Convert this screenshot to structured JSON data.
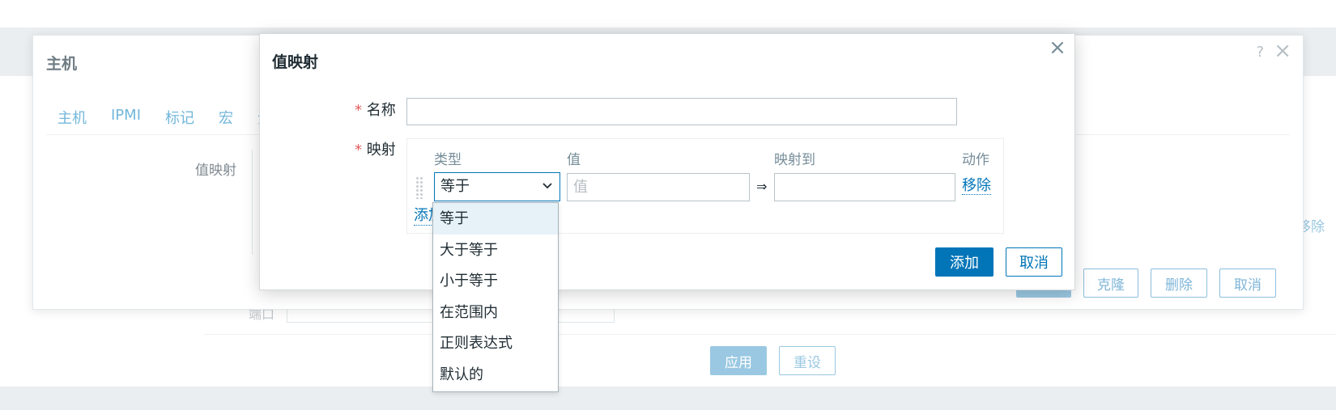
{
  "host_dialog": {
    "title": "主机",
    "help_icon": "?",
    "close_icon": "×",
    "tabs": [
      "主机",
      "IPMI",
      "标记",
      "宏",
      "资"
    ],
    "value_map_label": "值映射",
    "buttons": {
      "clone": "克隆",
      "delete": "删除",
      "cancel": "取消"
    },
    "remove_link_fragment": "移除"
  },
  "background_page": {
    "port_label": "端口",
    "apply_button": "应用",
    "reset_button": "重设"
  },
  "value_map_dialog": {
    "title": "值映射",
    "close_icon": "×",
    "name_label": "名称",
    "name_value": "",
    "mappings_label": "映射",
    "required_marker": "*",
    "columns": {
      "type": "类型",
      "value": "值",
      "mapped_to": "映射到",
      "action": "动作"
    },
    "row": {
      "type_selected": "等于",
      "value_placeholder": "值",
      "arrow": "⇒",
      "mapped_to_value": "",
      "remove_link": "移除"
    },
    "add_link": "添加",
    "buttons": {
      "add": "添加",
      "cancel": "取消"
    }
  },
  "type_dropdown": {
    "options": [
      "等于",
      "大于等于",
      "小于等于",
      "在范围内",
      "正则表达式",
      "默认的"
    ],
    "highlighted": "等于"
  },
  "colors": {
    "primary": "#0275b8",
    "required": "#e45959",
    "dim_link": "#73b7da"
  }
}
